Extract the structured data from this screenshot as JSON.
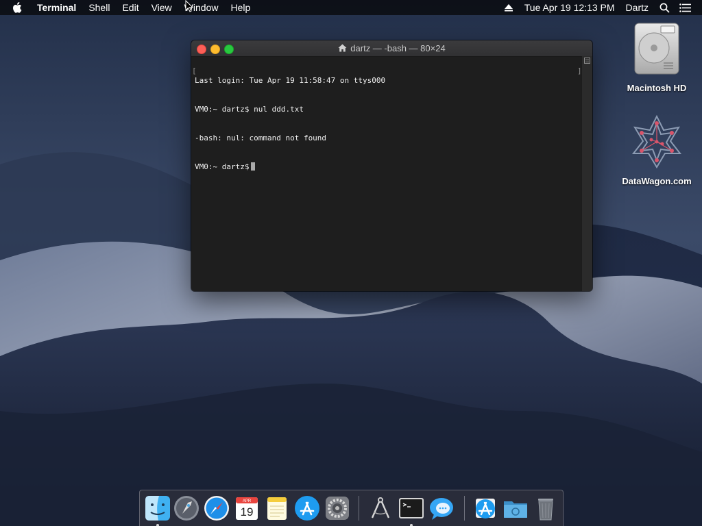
{
  "menubar": {
    "app_name": "Terminal",
    "items": [
      "Shell",
      "Edit",
      "View",
      "Window",
      "Help"
    ],
    "datetime": "Tue Apr 19  12:13 PM",
    "user": "Dartz",
    "icons": [
      "apple-icon",
      "eject-icon",
      "spotlight-search-icon",
      "notification-center-icon"
    ]
  },
  "terminal": {
    "title": "dartz — -bash — 80×24",
    "lines": [
      "Last login: Tue Apr 19 11:58:47 on ttys000",
      "VM0:~ dartz$ nul ddd.txt",
      "-bash: nul: command not found",
      "VM0:~ dartz$"
    ]
  },
  "desktop_icons": [
    {
      "label": "Macintosh HD",
      "icon": "hard-drive-icon"
    },
    {
      "label": "DataWagon.com",
      "icon": "datawagon-logo-icon"
    }
  ],
  "dock": {
    "items": [
      {
        "name": "Finder",
        "icon": "finder-icon",
        "running": true
      },
      {
        "name": "Launchpad",
        "icon": "launchpad-icon",
        "running": false
      },
      {
        "name": "Safari",
        "icon": "safari-icon",
        "running": false
      },
      {
        "name": "Calendar",
        "icon": "calendar-icon",
        "running": false,
        "month": "APR",
        "day": "19"
      },
      {
        "name": "Notes",
        "icon": "notes-icon",
        "running": false
      },
      {
        "name": "App Store",
        "icon": "app-store-icon",
        "running": false
      },
      {
        "name": "System Preferences",
        "icon": "system-preferences-icon",
        "running": false
      },
      {
        "name": "Directory Utility",
        "icon": "compass-tool-icon",
        "running": false
      },
      {
        "name": "Terminal",
        "icon": "terminal-icon",
        "running": true
      },
      {
        "name": "Messages",
        "icon": "messages-icon",
        "running": false
      },
      {
        "name": "Downloads",
        "icon": "downloads-stack-icon",
        "running": false
      },
      {
        "name": "Folder",
        "icon": "folder-icon",
        "running": false
      },
      {
        "name": "Trash",
        "icon": "trash-icon",
        "running": false
      }
    ]
  },
  "colors": {
    "menubar_bg": "#0c0e14",
    "terminal_bg": "#1e1e1e",
    "terminal_text": "#f0f0f0",
    "close": "#fd5f57",
    "minimize": "#febc2e",
    "zoom": "#28c840"
  }
}
